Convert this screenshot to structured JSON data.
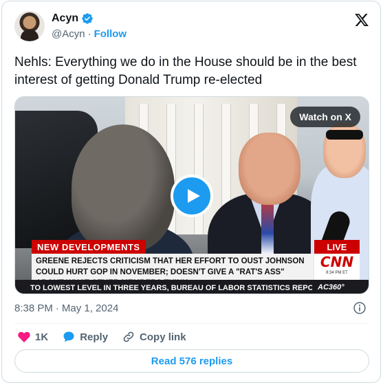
{
  "author": {
    "display_name": "Acyn",
    "handle": "@Acyn",
    "separator": "·",
    "follow_label": "Follow",
    "verified": true
  },
  "tweet": {
    "text": "Nehls: Everything we do in the House should be in the best interest of getting Donald Trump re-elected",
    "time": "8:38 PM",
    "separator": "·",
    "date": "May 1, 2024"
  },
  "media": {
    "watch_label": "Watch on X",
    "broadcast": {
      "banner": "NEW DEVELOPMENTS",
      "live_label": "LIVE",
      "headline": "GREENE REJECTS CRITICISM THAT HER EFFORT TO OUST JOHNSON COULD HURT GOP IN NOVEMBER; DOESN'T GIVE A \"RAT'S ASS\" ABOUT WHAT OTHER MEMBERS THINK",
      "network": "CNN",
      "network_time": "8:34 PM ET",
      "crawl": "TO LOWEST LEVEL IN THREE YEARS, BUREAU OF LABOR STATISTICS REPORTS ▸ U.S. E",
      "show": "AC360°"
    }
  },
  "actions": {
    "like_count": "1K",
    "reply_label": "Reply",
    "copy_link_label": "Copy link"
  },
  "read_replies_label": "Read 576 replies",
  "colors": {
    "accent": "#1d9bf0",
    "like": "#f91880",
    "cnn_red": "#cc0000"
  }
}
